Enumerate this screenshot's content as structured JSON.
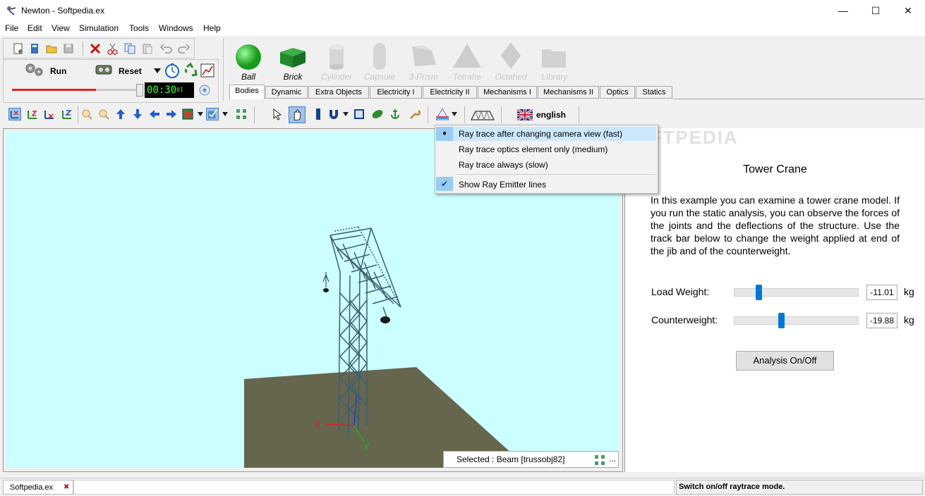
{
  "window": {
    "title": "Newton - Softpedia.ex",
    "minimize_glyph": "—",
    "maximize_glyph": "☐",
    "close_glyph": "✕"
  },
  "menu": [
    "File",
    "Edit",
    "View",
    "Simulation",
    "Tools",
    "Windows",
    "Help"
  ],
  "toolbar": {
    "run_label": "Run",
    "reset_label": "Reset",
    "timer": "00:30",
    "timer_suffix": "01",
    "progress": 0.66
  },
  "shapes": [
    {
      "label": "Ball",
      "enabled": true,
      "color": "#2ecc40"
    },
    {
      "label": "Brick",
      "enabled": true,
      "color": "#2a9a34"
    },
    {
      "label": "Cylinder",
      "enabled": false,
      "color": "#d0d0d0"
    },
    {
      "label": "Capsule",
      "enabled": false,
      "color": "#d0d0d0"
    },
    {
      "label": "3-Prism",
      "enabled": false,
      "color": "#c8c8c8"
    },
    {
      "label": "Tetrahe",
      "enabled": false,
      "color": "#c8c8c8"
    },
    {
      "label": "Octahed",
      "enabled": false,
      "color": "#c8c8c8"
    },
    {
      "label": "Library",
      "enabled": false,
      "color": "#d0d0d0"
    }
  ],
  "tabs": [
    "Bodies",
    "Dynamic",
    "Extra Objects",
    "Electricity I",
    "Electricity II",
    "Mechanisms I",
    "Mechanisms II",
    "Optics",
    "Statics"
  ],
  "active_tab": "Bodies",
  "language": {
    "label": "english"
  },
  "context_menu": {
    "items": [
      {
        "label": "Ray trace after changing camera view (fast)",
        "mark": "radio",
        "checked": true
      },
      {
        "label": "Ray trace optics element only (medium)",
        "mark": "radio",
        "checked": false
      },
      {
        "label": "Ray trace always (slow)",
        "mark": "radio",
        "checked": false
      },
      {
        "label": "Show Ray Emitter lines",
        "mark": "check",
        "checked": true
      }
    ],
    "radio_glyph": "●",
    "check_glyph": "✔"
  },
  "watermark": "SOFTPEDIA",
  "viewport": {
    "selected_text": "Selected : Beam [trussobj82]",
    "more": "...",
    "axis_x": "X",
    "axis_y": "Y",
    "sky_color": "#ccffff",
    "ground_color": "#66664f"
  },
  "panel": {
    "title": "Tower Crane",
    "description": "In this example you can examine a tower crane model. If you run the static analysis, you can observe the forces of the joints and the deflections of the structure. Use the track bar below to change the weight applied at end of the jib and of the counterweight.",
    "load_label": "Load Weight:",
    "load_value": "-11.01",
    "load_slider_fraction": 0.2,
    "counter_label": "Counterweight:",
    "counter_value": "-19.88",
    "counter_slider_fraction": 0.38,
    "unit": "kg",
    "analysis_button": "Analysis On/Off"
  },
  "statusbar": {
    "doc_tab": "Softpedia.ex",
    "close_glyph": "✖",
    "message": "Switch on/off raytrace mode."
  }
}
